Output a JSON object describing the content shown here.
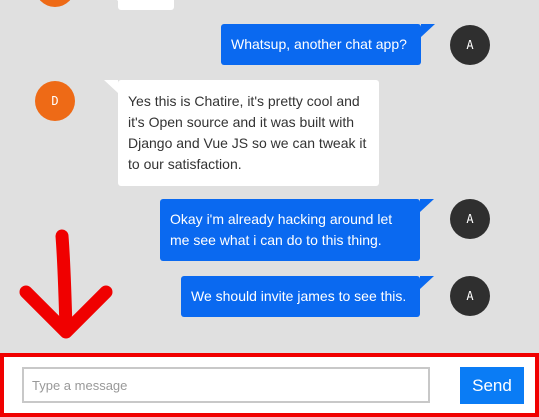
{
  "messages": [
    {
      "side": "in",
      "avatar": "D",
      "text": ""
    },
    {
      "side": "out",
      "avatar": "A",
      "text": "Whatsup, another chat app?"
    },
    {
      "side": "in",
      "avatar": "D",
      "text": "Yes this is Chatire, it's pretty cool and it's Open source and it was built with Django and Vue JS so we can tweak it to our satisfaction."
    },
    {
      "side": "out",
      "avatar": "A",
      "text": "Okay i'm already hacking around let me see what i can do to this thing."
    },
    {
      "side": "out",
      "avatar": "A",
      "text": "We should invite james to see this."
    }
  ],
  "composer": {
    "placeholder": "Type a message",
    "value": "",
    "send_label": "Send"
  },
  "colors": {
    "other_avatar": "#ee6a16",
    "self_avatar": "#2f2f2f",
    "outgoing_bubble": "#0a69f0",
    "send_button": "#0a7cf5",
    "annotation": "#f00000"
  },
  "icons": [
    "down-arrow-annotation"
  ]
}
